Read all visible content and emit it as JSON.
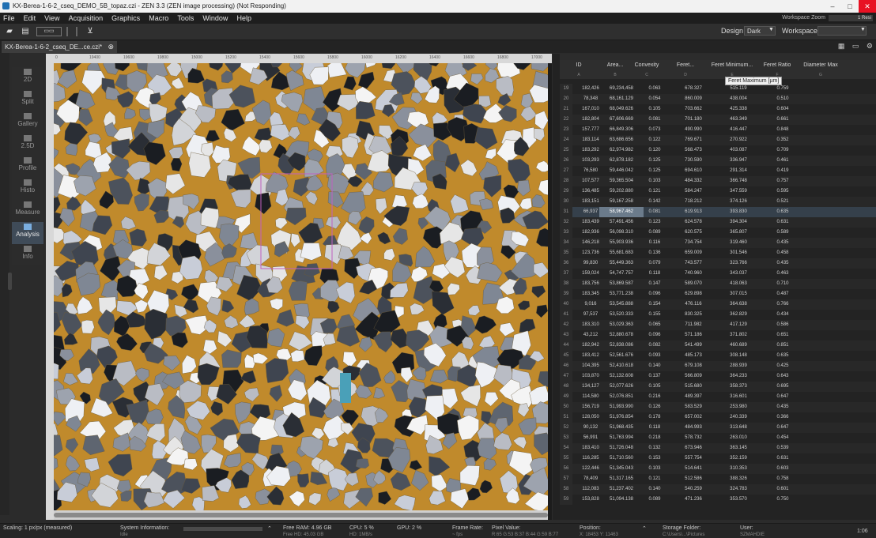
{
  "window": {
    "title": "KX-Berea-1-6-2_cseq_DEMO_5B_topaz.czi - ZEN 3.3 (ZEN image processing) (Not Responding)",
    "controls": [
      "–",
      "□",
      "✕"
    ]
  },
  "menu": {
    "items": [
      "File",
      "Edit",
      "View",
      "Acquisition",
      "Graphics",
      "Macro",
      "Tools",
      "Window",
      "Help"
    ],
    "workspace_zoom_label": "Workspace Zoom",
    "workspace_zoom_value": "1 Resi"
  },
  "toolbar": {
    "design_label": "Design",
    "design_value": "Dark",
    "workspace_label": "Workspace",
    "workspace_value": ""
  },
  "document_tab": {
    "label": "KX-Berea-1-6-2_cseq_DE...ce.czi*"
  },
  "view_nav": {
    "items": [
      {
        "label": "2D",
        "active": false
      },
      {
        "label": "Split",
        "active": false
      },
      {
        "label": "Gallery",
        "active": false
      },
      {
        "label": "2.5D",
        "active": false
      },
      {
        "label": "Profile",
        "active": false
      },
      {
        "label": "Histo",
        "active": false
      },
      {
        "label": "Measure",
        "active": false
      },
      {
        "label": "Analysis",
        "active": true
      },
      {
        "label": "Info",
        "active": false
      }
    ]
  },
  "ruler": {
    "top_ticks": [
      "0",
      "19400",
      "19600",
      "19800",
      "15000",
      "15200",
      "15400",
      "15600",
      "15800",
      "16000",
      "16200",
      "16400",
      "16600",
      "16800",
      "17000"
    ]
  },
  "colors": {
    "matrix": "#c08a2c",
    "accent": "#7aaee0",
    "selection": "#35404b"
  },
  "table": {
    "columns": [
      {
        "name": "ID",
        "letter": "A"
      },
      {
        "name": "Area...",
        "letter": "B"
      },
      {
        "name": "Convexity",
        "letter": "C"
      },
      {
        "name": "Feret...",
        "letter": "D"
      },
      {
        "name": "Feret Minimum...",
        "letter": "E"
      },
      {
        "name": "Feret Ratio",
        "letter": "F"
      },
      {
        "name": "Diameter Max",
        "letter": "G"
      }
    ],
    "tooltip": "Feret Maximum [µm]",
    "selected_row": 31,
    "rows": [
      {
        "n": "19",
        "v": [
          "182,426",
          "69,234,458",
          "0.063",
          "678.327",
          "515.119",
          "0.759"
        ]
      },
      {
        "n": "20",
        "v": [
          "78,348",
          "68,161.129",
          "0.054",
          "860.009",
          "438.004",
          "0.510"
        ]
      },
      {
        "n": "21",
        "v": [
          "167,010",
          "68,049.626",
          "0.105",
          "703.662",
          "425.338",
          "0.604"
        ]
      },
      {
        "n": "22",
        "v": [
          "182,804",
          "67,606.669",
          "0.081",
          "701.180",
          "463.349",
          "0.661"
        ]
      },
      {
        "n": "23",
        "v": [
          "157,777",
          "66,849.306",
          "0.073",
          "490.990",
          "416.447",
          "0.848"
        ]
      },
      {
        "n": "24",
        "v": [
          "183,114",
          "63,686.656",
          "0.122",
          "769.671",
          "270.922",
          "0.352"
        ]
      },
      {
        "n": "25",
        "v": [
          "183,292",
          "62,974.982",
          "0.120",
          "568.473",
          "403.087",
          "0.709"
        ]
      },
      {
        "n": "26",
        "v": [
          "103,293",
          "62,878.182",
          "0.125",
          "730.590",
          "336.947",
          "0.461"
        ]
      },
      {
        "n": "27",
        "v": [
          "76,580",
          "59,446.042",
          "0.125",
          "694.610",
          "291.314",
          "0.419"
        ]
      },
      {
        "n": "28",
        "v": [
          "107,577",
          "59,365.504",
          "0.103",
          "484.332",
          "366.748",
          "0.757"
        ]
      },
      {
        "n": "29",
        "v": [
          "136,485",
          "59,202.880",
          "0.121",
          "584.247",
          "347.559",
          "0.595"
        ]
      },
      {
        "n": "30",
        "v": [
          "183,151",
          "59,167.258",
          "0.142",
          "718.212",
          "374.126",
          "0.521"
        ]
      },
      {
        "n": "31",
        "v": [
          "66,937",
          "58,967.462",
          "0.081",
          "619.913",
          "393.830",
          "0.635"
        ]
      },
      {
        "n": "32",
        "v": [
          "183,439",
          "57,491.456",
          "0.123",
          "624.578",
          "394.304",
          "0.631"
        ]
      },
      {
        "n": "33",
        "v": [
          "182,936",
          "56,098.310",
          "0.089",
          "620.575",
          "365.807",
          "0.589"
        ]
      },
      {
        "n": "34",
        "v": [
          "146,218",
          "55,903.936",
          "0.116",
          "734.754",
          "319.460",
          "0.435"
        ]
      },
      {
        "n": "35",
        "v": [
          "123,736",
          "55,681.683",
          "0.136",
          "659.009",
          "301.546",
          "0.458"
        ]
      },
      {
        "n": "36",
        "v": [
          "99,830",
          "55,449.363",
          "0.079",
          "743.577",
          "323.766",
          "0.435"
        ]
      },
      {
        "n": "37",
        "v": [
          "159,024",
          "54,747.757",
          "0.118",
          "740.960",
          "343.037",
          "0.463"
        ]
      },
      {
        "n": "38",
        "v": [
          "183,756",
          "53,869.587",
          "0.147",
          "589.070",
          "418.063",
          "0.710"
        ]
      },
      {
        "n": "39",
        "v": [
          "183,345",
          "53,771.238",
          "0.096",
          "629.898",
          "307.015",
          "0.487"
        ]
      },
      {
        "n": "40",
        "v": [
          "9,016",
          "53,545.888",
          "0.154",
          "476.116",
          "364.638",
          "0.766"
        ]
      },
      {
        "n": "41",
        "v": [
          "97,537",
          "53,520.333",
          "0.155",
          "830.325",
          "362.829",
          "0.434"
        ]
      },
      {
        "n": "42",
        "v": [
          "183,310",
          "53,029.363",
          "0.065",
          "711.982",
          "417.129",
          "0.586"
        ]
      },
      {
        "n": "43",
        "v": [
          "43,212",
          "52,880.678",
          "0.096",
          "571.186",
          "371.802",
          "0.651"
        ]
      },
      {
        "n": "44",
        "v": [
          "182,942",
          "52,838.086",
          "0.082",
          "541.499",
          "460.689",
          "0.851"
        ]
      },
      {
        "n": "45",
        "v": [
          "183,412",
          "52,561.676",
          "0.093",
          "485.173",
          "308.148",
          "0.635"
        ]
      },
      {
        "n": "46",
        "v": [
          "104,395",
          "52,410.618",
          "0.140",
          "679.108",
          "288.939",
          "0.425"
        ]
      },
      {
        "n": "47",
        "v": [
          "103,870",
          "52,132.608",
          "0.137",
          "566.809",
          "364.233",
          "0.643"
        ]
      },
      {
        "n": "48",
        "v": [
          "134,127",
          "52,077.626",
          "0.105",
          "515.680",
          "358.373",
          "0.695"
        ]
      },
      {
        "n": "49",
        "v": [
          "114,580",
          "52,076.851",
          "0.216",
          "489.397",
          "316.601",
          "0.647"
        ]
      },
      {
        "n": "50",
        "v": [
          "156,719",
          "51,993.990",
          "0.126",
          "583.529",
          "253.980",
          "0.435"
        ]
      },
      {
        "n": "51",
        "v": [
          "128,050",
          "51,976.854",
          "0.178",
          "657.002",
          "240.339",
          "0.366"
        ]
      },
      {
        "n": "52",
        "v": [
          "90,132",
          "51,968.435",
          "0.118",
          "484.993",
          "313.648",
          "0.647"
        ]
      },
      {
        "n": "53",
        "v": [
          "56,991",
          "51,763.994",
          "0.218",
          "578.732",
          "263.010",
          "0.454"
        ]
      },
      {
        "n": "54",
        "v": [
          "183,410",
          "51,726.048",
          "0.132",
          "673.946",
          "363.145",
          "0.539"
        ]
      },
      {
        "n": "55",
        "v": [
          "116,285",
          "51,710.560",
          "0.153",
          "557.754",
          "352.159",
          "0.631"
        ]
      },
      {
        "n": "56",
        "v": [
          "122,446",
          "51,345.043",
          "0.103",
          "514.641",
          "310.353",
          "0.603"
        ]
      },
      {
        "n": "57",
        "v": [
          "78,409",
          "51,317.165",
          "0.121",
          "512.586",
          "388.326",
          "0.758"
        ]
      },
      {
        "n": "58",
        "v": [
          "112,083",
          "51,237.402",
          "0.140",
          "540.259",
          "324.783",
          "0.601"
        ]
      },
      {
        "n": "59",
        "v": [
          "153,828",
          "51,094.138",
          "0.089",
          "471.236",
          "353.570",
          "0.750"
        ]
      }
    ]
  },
  "status": {
    "scaling": "Scaling: 1 px/px (measured)",
    "sysinfo_label": "System Information:",
    "sysinfo_sub": "Idle",
    "free_ram": "Free RAM: 4.96 GB",
    "free_hd": "Free HD: 45.03 GB",
    "cpu": "CPU: 5 %",
    "cpu_sub": "HD: 1MB/s",
    "gpu": "GPU: 2 %",
    "frame_rate": "Frame Rate:",
    "frame_rate_sub": "~ fps",
    "pixel_value": "Pixel Value:",
    "pixel_value_sub": "R:65 G:53 B:37 B:44 G:59 B:77",
    "position": "Position:",
    "position_sub": "X: 18453  Y: 11463",
    "storage": "Storage Folder:",
    "storage_sub": "C:\\Users\\...\\Pictures",
    "user": "User:",
    "user_sub": "SZMAHDIE",
    "time": "1:06"
  }
}
